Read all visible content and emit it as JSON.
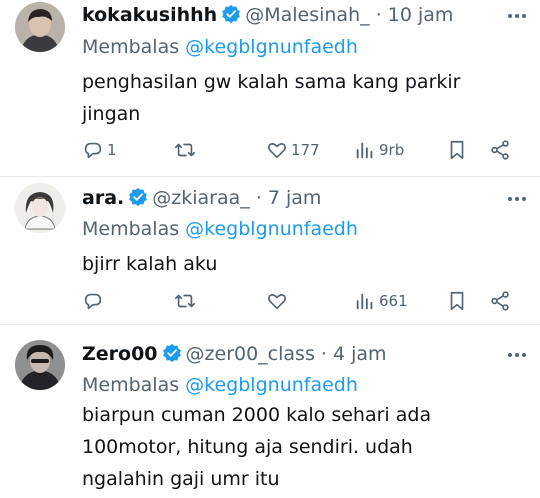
{
  "replies": [
    {
      "name": "kokakusihhh",
      "handle": "@Malesinah_",
      "dot": "·",
      "time": "10 jam",
      "replying_label": "Membalas",
      "replying_to": "@kegblgnunfaedh",
      "text_lines": [
        "penghasilan gw kalah sama kang parkir",
        "jingan"
      ],
      "reply_count": "1",
      "retweet_count": "",
      "like_count": "177",
      "view_count": "9rb"
    },
    {
      "name": "ara.",
      "handle": "@zkiaraa_",
      "dot": "·",
      "time": "7 jam",
      "replying_label": "Membalas",
      "replying_to": "@kegblgnunfaedh",
      "text_lines": [
        "bjirr kalah aku"
      ],
      "reply_count": "",
      "retweet_count": "",
      "like_count": "",
      "view_count": "661"
    },
    {
      "name": "Zero00",
      "handle": "@zer00_class",
      "dot": "·",
      "time": "4 jam",
      "replying_label": "Membalas",
      "replying_to": "@kegblgnunfaedh",
      "text_lines": [
        "biarpun cuman 2000 kalo sehari ada",
        "100motor, hitung aja sendiri. udah",
        "ngalahin gaji umr itu"
      ],
      "reply_count": "",
      "retweet_count": "",
      "like_count": "",
      "view_count": ""
    }
  ],
  "colors": {
    "accent": "#1d9bf0",
    "muted": "#536471",
    "text": "#0f1419",
    "divider": "#e6e9ec"
  },
  "icons": [
    "verified-badge-icon",
    "more-icon",
    "reply-icon",
    "retweet-icon",
    "like-icon",
    "views-icon",
    "bookmark-icon",
    "share-icon"
  ]
}
